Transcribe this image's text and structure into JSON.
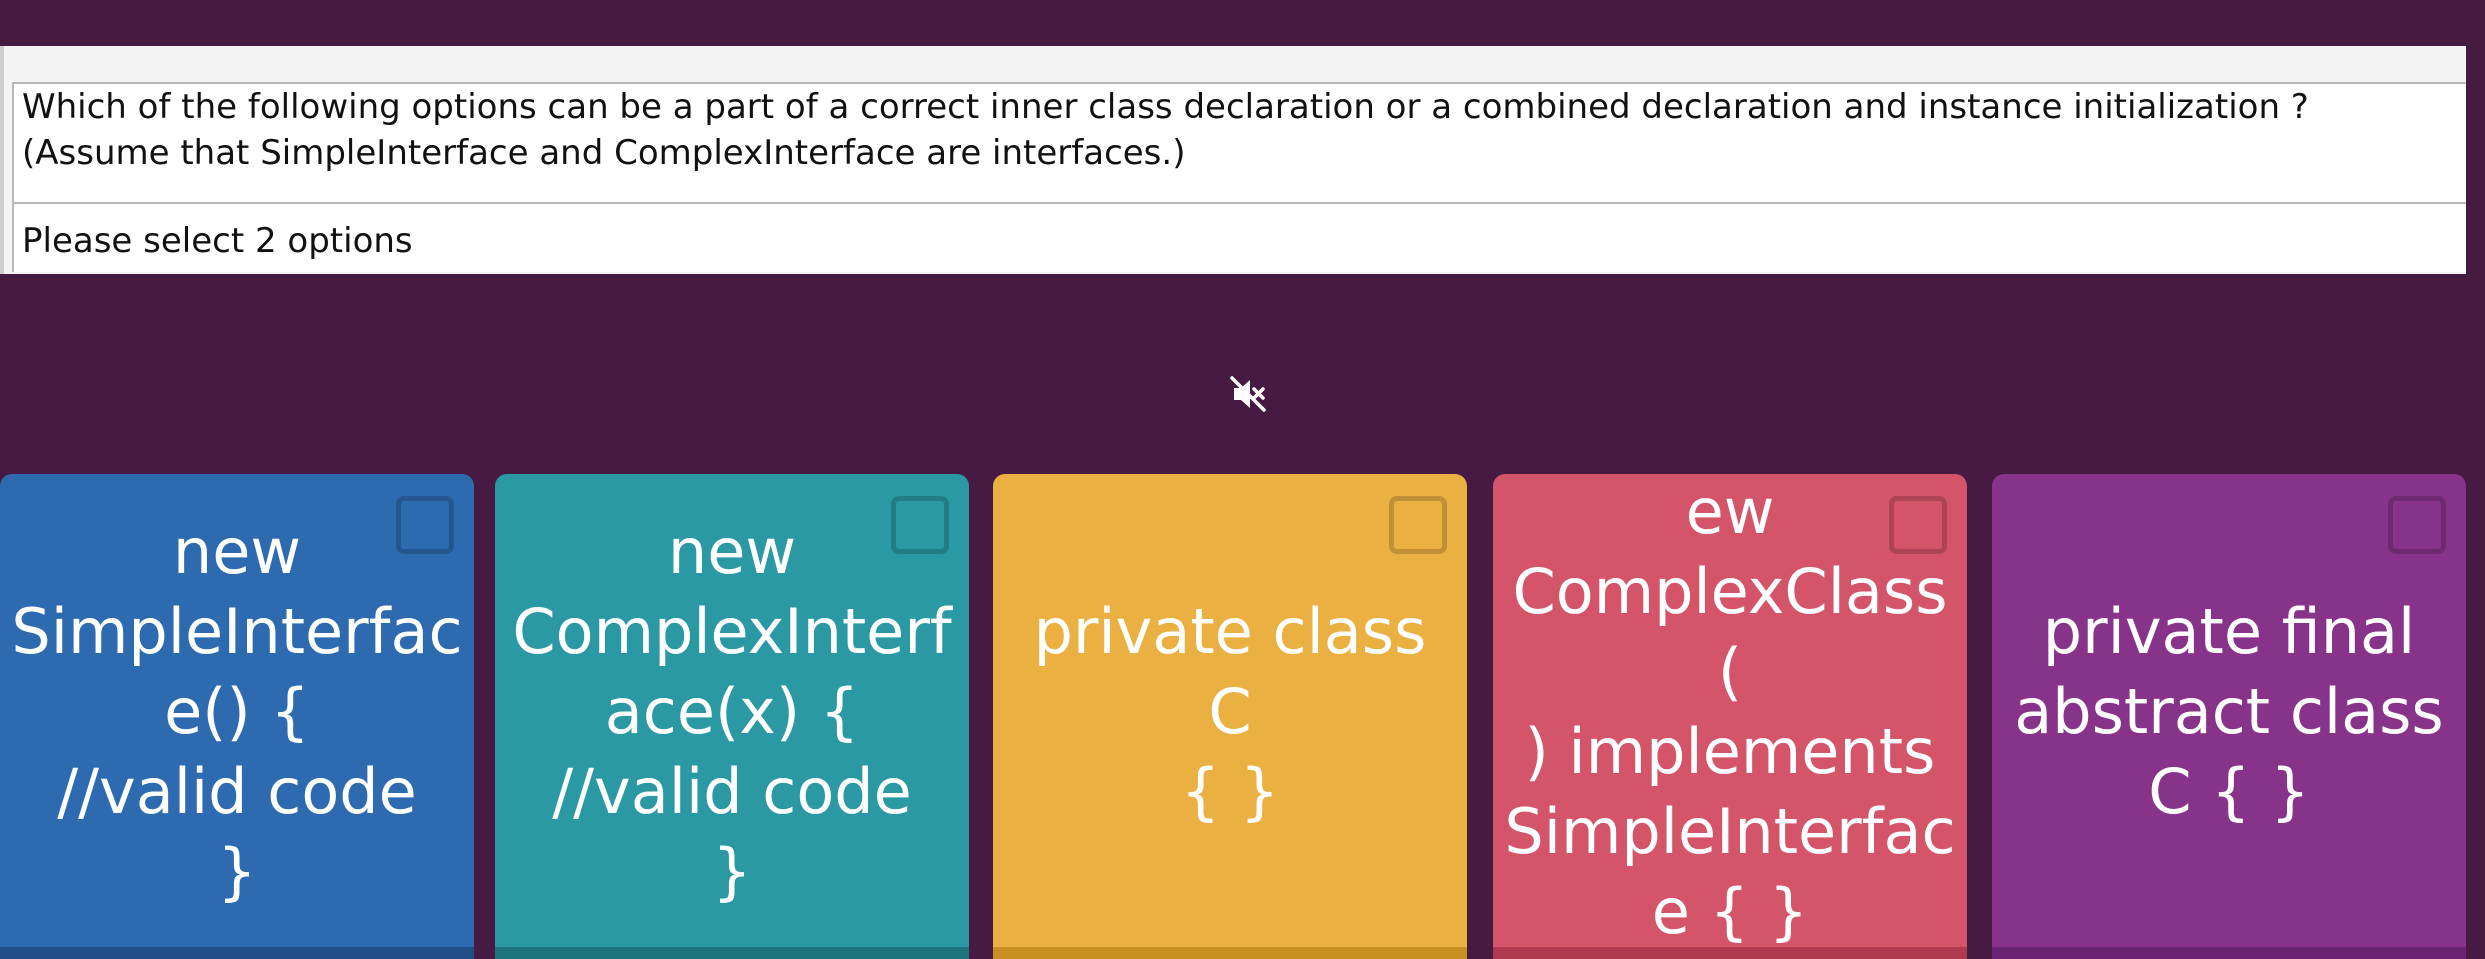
{
  "question": {
    "lines": [
      "Which of the following options can be a part of a correct inner class declaration or a combined declaration and instance initialization ?",
      "(Assume that SimpleInterface and ComplexInterface are interfaces.)"
    ],
    "instruction": "Please select 2 options"
  },
  "mute_icon": "speaker-muted-icon",
  "colors": {
    "background": "#461a42",
    "card_blue": "#2d6aaf",
    "card_teal": "#2a99a3",
    "card_yellow": "#ebb042",
    "card_red": "#d4546a",
    "card_purple": "#88338a"
  },
  "answers": [
    {
      "lines": [
        "new",
        "SimpleInterfac",
        "e() {",
        "//valid code",
        "}"
      ],
      "checked": false
    },
    {
      "lines": [
        "new",
        "ComplexInterf",
        "ace(x) {",
        "//valid code",
        "}"
      ],
      "checked": false
    },
    {
      "lines": [
        "private class C",
        "{ }"
      ],
      "checked": false
    },
    {
      "lines": [
        "ew",
        "ComplexClass(",
        ") implements",
        "SimpleInterfac",
        "e { }"
      ],
      "checked": false
    },
    {
      "lines": [
        "private final",
        "abstract class",
        "C { }"
      ],
      "checked": false
    }
  ]
}
